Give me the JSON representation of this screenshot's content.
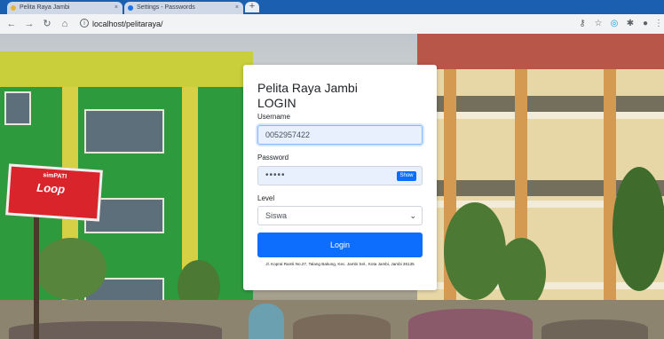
{
  "browser": {
    "tabs": [
      {
        "label": "Pelita Raya Jambi",
        "close": "×"
      },
      {
        "label": "Settings - Passwords",
        "close": "×"
      }
    ],
    "new_tab": "+",
    "url": "localhost/pelitaraya/"
  },
  "form": {
    "brand": "Pelita Raya Jambi",
    "heading": "LOGIN",
    "username_label": "Username",
    "username_value": "0052957422",
    "password_label": "Password",
    "password_value": "•••••",
    "show_label": "Show",
    "level_label": "Level",
    "level_value": "Siswa",
    "login_label": "Login",
    "address": "Jl. Kopral Ramli No.27, Talang Bakung, Kec. Jambi Sel., Kota Jambi, Jambi 36135"
  },
  "background": {
    "billboard_top": "simPATI",
    "billboard_word": "Loop"
  },
  "colors": {
    "primary": "#0d6efd",
    "tabbar": "#1b5fb0",
    "school_green": "#2e9a3e"
  }
}
